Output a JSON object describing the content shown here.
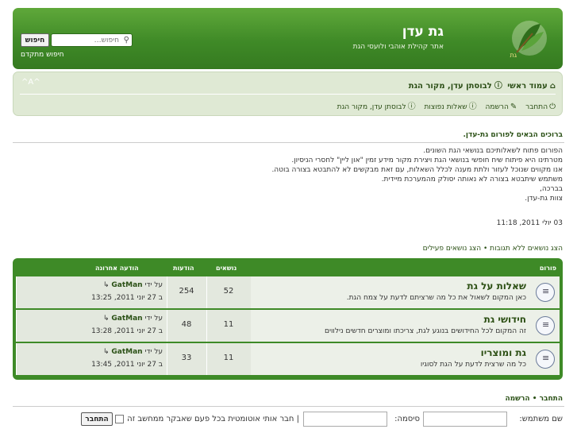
{
  "header": {
    "title": "גת עדן",
    "description": "אתר קהילת אוהבי ולועסי הגת",
    "search_placeholder": "חיפוש…",
    "search_button": "חיפוש",
    "advanced_search": "חיפוש מתקדם"
  },
  "navbar": {
    "font_control": "^A^",
    "breadcrumb_home": "עמוד ראשי",
    "breadcrumb_forum": "לבוסתן עדן, מקור הגת",
    "faq": "שאלות נפוצות",
    "register": "הרשמה",
    "login": "התחבר",
    "left_link": "לבוסתן עדן, מקור הגת"
  },
  "welcome": {
    "title": "ברוכים הבאים לפורום גת-עדן.",
    "lines": [
      "הפורום פתוח לשאלותיכם בנושאי הגת השונים.",
      "מטרתינו היא פיתוח שיח חופשי בנושאי הגת ויצירת מקור מידע זמין \"און ליין\" לחסרי הניסיון.",
      "אנו מקווים שנוכל לעזור ולתת מענה לכלל השאלות, עם זאת מבקשים לא להתבטא בצורה בוטה.",
      "משתמש שיתבטא בצורה לא נאותה יסולק מהמערכת מיידית.",
      "בברכה,",
      "צוות גת-עדן."
    ],
    "date": "03 יולי 2011, 11:18"
  },
  "quick_links": "הצג נושאים ללא תגובות • הצג נושאים פעילים",
  "forum_table": {
    "headers": {
      "forum": "פורום",
      "topics": "נושאים",
      "posts": "הודעות",
      "last_post": "הודעה אחרונה"
    },
    "rows": [
      {
        "title": "שאלות על גת",
        "desc": "כאן המקום לשאול את כל מה שרציתם לדעת על צמח הגת.",
        "topics": "52",
        "posts": "254",
        "last_by": "על ידי",
        "last_user": "GatMan",
        "last_date": "ב 27 יוני 2011, 13:25"
      },
      {
        "title": "חידושי גת",
        "desc": "זה המקום לכל החידושים בנוגע לגת, צריכתו ומוצרים חדשים נילווים",
        "topics": "11",
        "posts": "48",
        "last_by": "על ידי",
        "last_user": "GatMan",
        "last_date": "ב 27 יוני 2011, 13:28"
      },
      {
        "title": "גת ומוצריו",
        "desc": "כל מה שרצית לדעת על הגת לסוגיו",
        "topics": "11",
        "posts": "33",
        "last_by": "על ידי",
        "last_user": "GatMan",
        "last_date": "ב 27 יוני 2011, 13:45"
      }
    ]
  },
  "login": {
    "title": "התחבר • הרשמה",
    "username_label": "שם משתמש:",
    "password_label": "סיסמה:",
    "remember_label": "| חבר אותי אוטומטית בכל פעם שאבקר ממחשב זה",
    "button": "התחבר"
  },
  "colors": {
    "header_green": "#3f8a27",
    "navbar_bg": "#dfe9d4",
    "link_green": "#2a5015"
  }
}
